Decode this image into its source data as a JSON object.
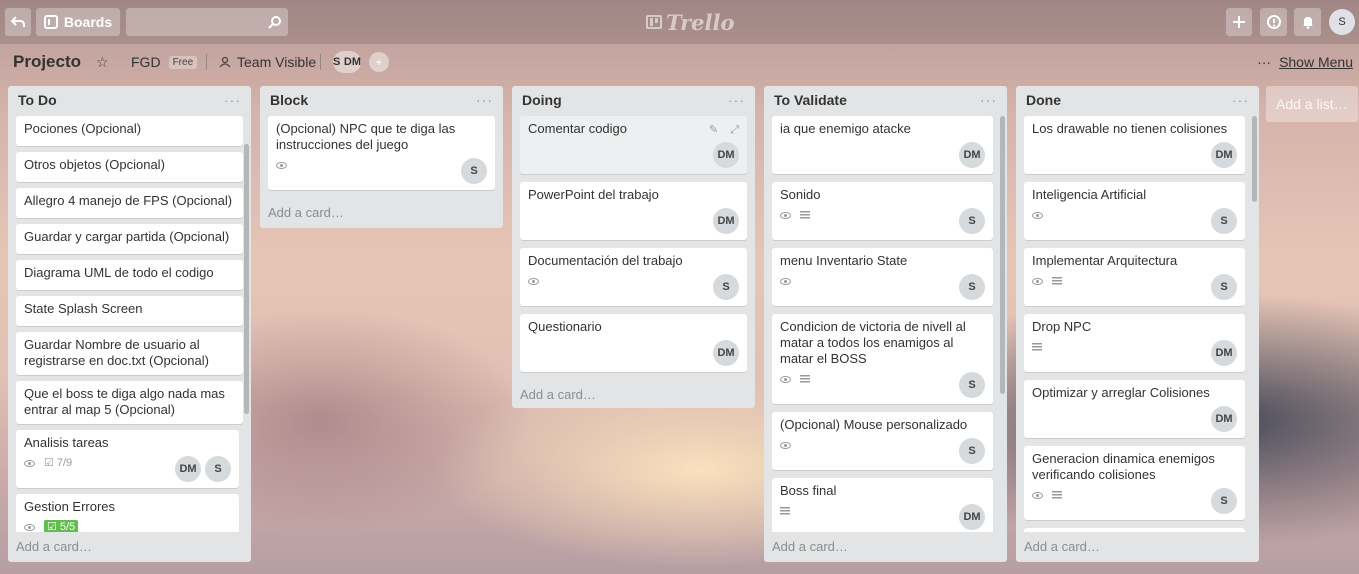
{
  "topbar": {
    "boards_label": "Boards",
    "search_value": "",
    "logo_text": "Trello",
    "user_initial": "S"
  },
  "board": {
    "title": "Projecto",
    "team": "FGD",
    "plan": "Free",
    "visibility": "Team Visible",
    "members": [
      "S",
      "DM"
    ],
    "menu_dots": "···",
    "show_menu": "Show Menu"
  },
  "list_menu": "···",
  "add_card_label": "Add a card…",
  "add_list_label": "Add a list…",
  "lists": [
    {
      "title": "To Do",
      "cards": [
        {
          "title": "Pociones (Opcional)"
        },
        {
          "title": "Otros objetos (Opcional)"
        },
        {
          "title": "Allegro 4 manejo de FPS (Opcional)"
        },
        {
          "title": "Guardar y cargar partida (Opcional)"
        },
        {
          "title": "Diagrama UML de todo el codigo"
        },
        {
          "title": "State Splash Screen"
        },
        {
          "title": "Guardar Nombre de usuario al registrarse en doc.txt (Opcional)"
        },
        {
          "title": "Que el boss te diga algo nada mas entrar al map 5 (Opcional)"
        },
        {
          "title": "Analisis tareas",
          "checklist": "7/9",
          "members": [
            "DM",
            "S"
          ]
        },
        {
          "title": "Gestion Errores",
          "checklist": "5/5"
        }
      ]
    },
    {
      "title": "Block",
      "cards": [
        {
          "title": "(Opcional) NPC que te diga las instrucciones del juego",
          "members": [
            "S"
          ]
        }
      ]
    },
    {
      "title": "Doing",
      "cards": [
        {
          "title": "Comentar codigo",
          "members": [
            "DM"
          ]
        },
        {
          "title": "PowerPoint del trabajo",
          "members": [
            "DM"
          ]
        },
        {
          "title": "Documentación del trabajo",
          "members": [
            "S"
          ]
        },
        {
          "title": "Questionario",
          "members": [
            "DM"
          ]
        }
      ]
    },
    {
      "title": "To Validate",
      "cards": [
        {
          "title": "ia que enemigo atacke",
          "members": [
            "DM"
          ]
        },
        {
          "title": "Sonido",
          "members": [
            "S"
          ]
        },
        {
          "title": "menu Inventario State",
          "members": [
            "S"
          ]
        },
        {
          "title": "Condicion de victoria de nivell al matar a todos los enamigos al matar el BOSS",
          "members": [
            "S"
          ]
        },
        {
          "title": "(Opcional) Mouse personalizado",
          "members": [
            "S"
          ]
        },
        {
          "title": "Boss final",
          "members": [
            "DM"
          ]
        }
      ]
    },
    {
      "title": "Done",
      "cards": [
        {
          "title": "Los drawable no tienen colisiones",
          "members": [
            "DM"
          ]
        },
        {
          "title": "Inteligencia Artificial",
          "members": [
            "S"
          ]
        },
        {
          "title": "Implementar Arquitectura",
          "members": [
            "S"
          ]
        },
        {
          "title": "Drop NPC",
          "members": [
            "DM"
          ]
        },
        {
          "title": "Optimizar y arreglar Colisiones",
          "members": [
            "DM"
          ]
        },
        {
          "title": "Generacion dinamica enemigos verificando colisiones",
          "members": [
            "S"
          ]
        }
      ]
    }
  ]
}
